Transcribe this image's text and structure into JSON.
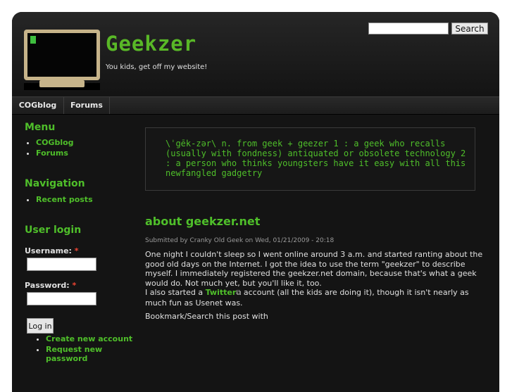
{
  "header": {
    "site_name": "Geekzer",
    "slogan": "You kids, get off my website!"
  },
  "search": {
    "value": "",
    "button_label": "Search"
  },
  "topnav": [
    {
      "label": "COGblog"
    },
    {
      "label": "Forums"
    }
  ],
  "sidebar": {
    "menu": {
      "title": "Menu",
      "items": [
        {
          "label": "COGblog"
        },
        {
          "label": "Forums"
        }
      ]
    },
    "navigation": {
      "title": "Navigation",
      "items": [
        {
          "label": "Recent posts"
        }
      ]
    },
    "login": {
      "title": "User login",
      "username_label": "Username:",
      "password_label": "Password:",
      "required_marker": "*",
      "button_label": "Log in",
      "links": [
        {
          "label": "Create new account"
        },
        {
          "label": "Request new password"
        }
      ]
    }
  },
  "content": {
    "definition": "\\ˈgēk-zər\\ n. from geek + geezer 1 : a geek who recalls (usually with fondness) antiquated or obsolete technology 2 : a person who thinks youngsters have it easy with all this newfangled gadgetry",
    "node": {
      "title": "about geekzer.net",
      "submitted": "Submitted by Cranky Old Geek on Wed, 01/21/2009 - 20:18",
      "para1": "One night I couldn't sleep so I went online around 3 a.m. and started ranting about the good old days on the Internet. I got the idea to use the term \"geekzer\" to describe myself. I immediately registered the geekzer.net domain, because that's what a geek would do. Not much yet, but you'll like it, too.",
      "para2_before": "I also started a ",
      "para2_link": "Twitter",
      "para2_after": " account (all the kids are doing it), though it isn't nearly as much fun as Usenet was.",
      "bookmark": "Bookmark/Search this post with"
    }
  },
  "icons": {
    "logo": "computer-monitor-icon",
    "external_link": "external-link-icon"
  },
  "colors": {
    "accent": "#4fbf2a",
    "background": "#141414",
    "text": "#e0e0e0"
  }
}
